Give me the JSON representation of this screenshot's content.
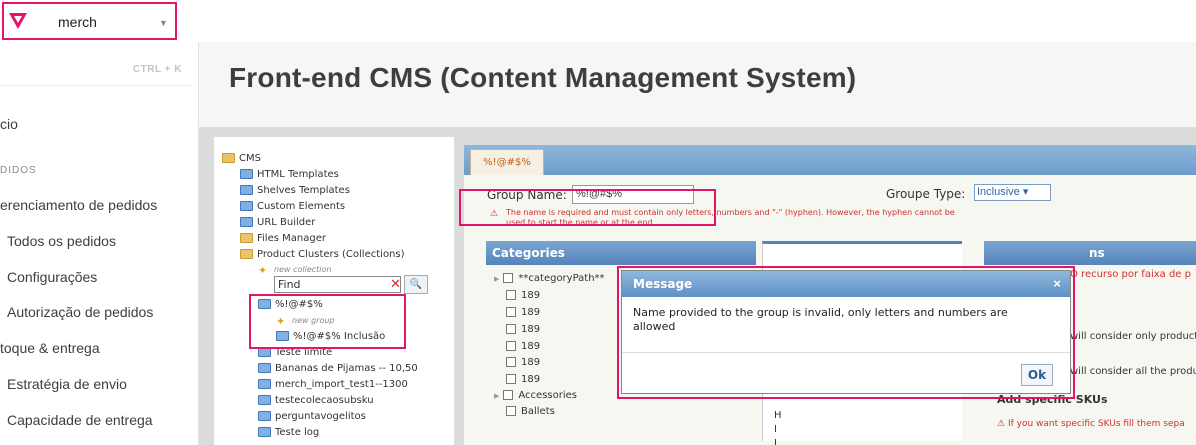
{
  "topbar": {
    "store_name": "merch",
    "caret": "▼"
  },
  "sidebar": {
    "search_shortcut": "CTRL + K",
    "items": [
      {
        "label": "cio"
      },
      {
        "label": "DIDOS"
      },
      {
        "label": "erenciamento de pedidos"
      },
      {
        "label": "Todos os pedidos"
      },
      {
        "label": "Configurações"
      },
      {
        "label": "Autorização de pedidos"
      },
      {
        "label": "toque & entrega"
      },
      {
        "label": "Estratégia de envio"
      },
      {
        "label": "Capacidade de entrega"
      }
    ]
  },
  "main": {
    "title": "Front-end CMS (Content Management System)"
  },
  "tree": {
    "items": [
      {
        "label": "CMS"
      },
      {
        "label": "HTML Templates"
      },
      {
        "label": "Shelves Templates"
      },
      {
        "label": "Custom Elements"
      },
      {
        "label": "URL Builder"
      },
      {
        "label": "Files Manager"
      },
      {
        "label": "Product Clusters (Collections)"
      },
      {
        "label": "new collection"
      },
      {
        "label": "%!@#$%"
      },
      {
        "label": "new group"
      },
      {
        "label": "%!@#$% Inclusão"
      },
      {
        "label": "Teste limite"
      },
      {
        "label": "Bananas de Pijamas -- 10,50"
      },
      {
        "label": "merch_import_test1--1300"
      },
      {
        "label": "testecolecaosubsku"
      },
      {
        "label": "perguntavogelitos"
      },
      {
        "label": "Teste log"
      }
    ],
    "find_value": "Find"
  },
  "editor": {
    "tab_label": "%!@#$%",
    "group_name_label": "Group Name:",
    "group_name_value": "%!@#$%",
    "group_type_label": "Groupe Type:",
    "group_type_value": "Inclusive ▾",
    "warning": "The name is required and must contain only letters, numbers and \"-\" (hyphen). However, the hyphen cannot be used to start the name or at the end.",
    "categories_title": "Categories",
    "right_title": "ns",
    "categories": [
      "**categoryPath**",
      "189",
      "189",
      "189",
      "189",
      "189",
      "189",
      "Accessories",
      "Ballets"
    ],
    "letters": [
      "H",
      "I",
      "J"
    ],
    "right_lines": [
      {
        "text": "O recurso por faixa de p"
      },
      {
        "text": "will consider only product"
      },
      {
        "text": "will consider all the produ"
      },
      {
        "text": "Add specific SKUs"
      },
      {
        "text": "If you want specific SKUs fill them sepa"
      }
    ]
  },
  "dialog": {
    "title": "Message",
    "close": "×",
    "message": "Name provided to the group is invalid, only letters and numbers are allowed",
    "ok": "Ok"
  }
}
